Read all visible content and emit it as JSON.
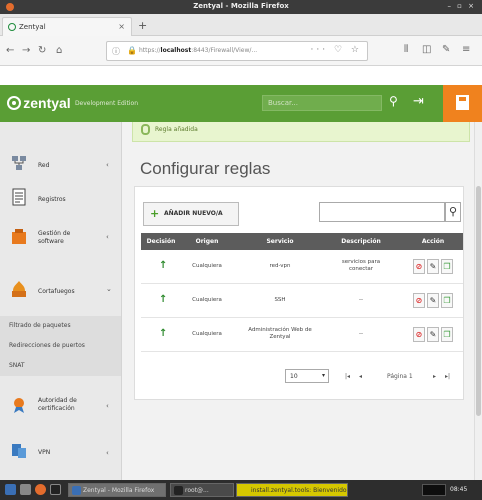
{
  "window": {
    "title": "Zentyal - Mozilla Firefox"
  },
  "browser": {
    "tab_label": "Zentyal",
    "url_host": "localhost",
    "url_prefix": "https://",
    "url_rest": ":8443/Firewall/View/..."
  },
  "header": {
    "brand": "zentyal",
    "edition": "Development Edition",
    "search_placeholder": "Buscar..."
  },
  "sidebar": {
    "items": [
      {
        "label": "Red",
        "icon": "network-icon",
        "arrow": "‹"
      },
      {
        "label": "Registros",
        "icon": "logs-icon",
        "arrow": ""
      },
      {
        "label": "Gestión de software",
        "icon": "software-management-icon",
        "arrow": "‹"
      },
      {
        "label": "Cortafuegos",
        "icon": "firewall-icon",
        "arrow": "⌄"
      },
      {
        "label": "Autoridad de certificación",
        "icon": "certificate-authority-icon",
        "arrow": "‹"
      },
      {
        "label": "VPN",
        "icon": "vpn-icon",
        "arrow": "‹"
      }
    ],
    "submenu": [
      "Filtrado de paquetes",
      "Redirecciones de puertos",
      "SNAT"
    ]
  },
  "notice": {
    "text": "Regla añadida"
  },
  "page": {
    "title": "Configurar reglas"
  },
  "toolbar": {
    "add_label": "AÑADIR NUEVO/A"
  },
  "table": {
    "headers": [
      "Decisión",
      "Origen",
      "Servicio",
      "Descripción",
      "Acción"
    ],
    "rows": [
      {
        "decision": "↑",
        "origin": "Cualquiera",
        "service": "red-vpn",
        "description": "servicios para conectar"
      },
      {
        "decision": "↑",
        "origin": "Cualquiera",
        "service": "SSH",
        "description": "--"
      },
      {
        "decision": "↑",
        "origin": "Cualquiera",
        "service": "Administración Web de Zentyal",
        "description": "--"
      }
    ]
  },
  "pagination": {
    "page_size": "10",
    "page_label": "Página 1"
  },
  "taskbar": {
    "tasks": [
      "Zentyal - Mozilla Firefox",
      "root@...",
      "install.zentyal.tools: Bienvenido"
    ],
    "clock": "08:45"
  },
  "colors": {
    "brand_green": "#5a9e35",
    "save_orange": "#f0821e",
    "table_header": "#5c5c5c"
  }
}
